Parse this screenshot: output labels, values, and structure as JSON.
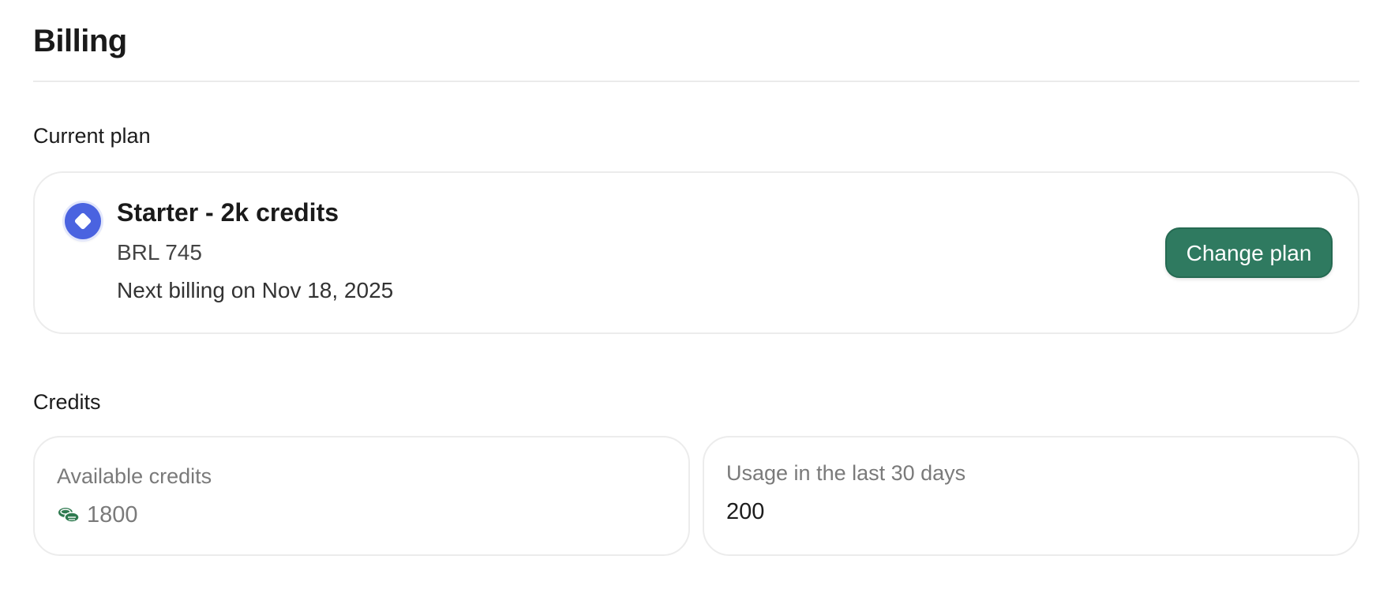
{
  "page": {
    "title": "Billing"
  },
  "current_plan": {
    "section_label": "Current plan",
    "icon": "plan-badge-icon",
    "name": "Starter - 2k credits",
    "price": "BRL 745",
    "next_billing": "Next billing on Nov 18, 2025",
    "change_button_label": "Change plan"
  },
  "credits": {
    "section_label": "Credits",
    "available": {
      "label": "Available credits",
      "icon": "coins-icon",
      "value": "1800"
    },
    "usage": {
      "label": "Usage in the last 30 days",
      "value": "200"
    }
  },
  "colors": {
    "accent_green": "#2f7a60",
    "plan_icon_blue": "#4a63e0",
    "coins_green": "#2f7a50"
  }
}
